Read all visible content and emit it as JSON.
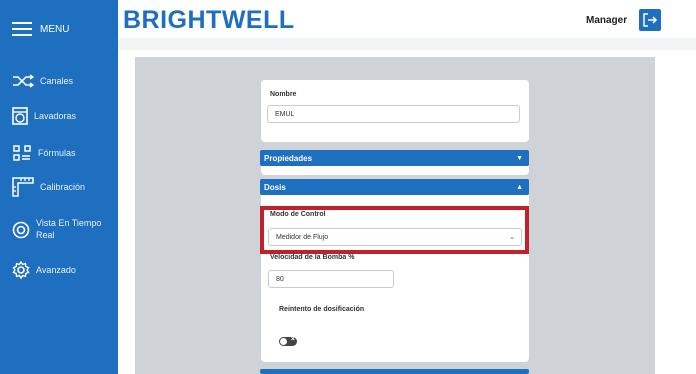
{
  "sidebar": {
    "menu_label": "MENU",
    "items": [
      {
        "label": "Canales",
        "icon": "shuffle-icon"
      },
      {
        "label": "Lavadoras",
        "icon": "washer-icon"
      },
      {
        "label": "Fórmulas",
        "icon": "formula-icon"
      },
      {
        "label": "Calibración",
        "icon": "ruler-icon"
      },
      {
        "label": "Vista En Tiempo Real",
        "icon": "eye-icon"
      },
      {
        "label": "Avanzado",
        "icon": "gear-icon"
      }
    ]
  },
  "header": {
    "logo": "BRIGHTWELL",
    "user": "Manager"
  },
  "form": {
    "name_label": "Nombre",
    "name_value": "EMUL",
    "properties_label": "Propiedades",
    "dosis_label": "Dosis",
    "control_mode_label": "Modo de Control",
    "control_mode_value": "Medidor de Flujo",
    "pump_speed_label": "Velocidad de la Bomba %",
    "pump_speed_value": "80",
    "retry_label": "Reintento de dosificación"
  },
  "colors": {
    "brand": "#1f6fc1",
    "highlight": "#c0212a",
    "content_bg": "#cfd3d8"
  }
}
